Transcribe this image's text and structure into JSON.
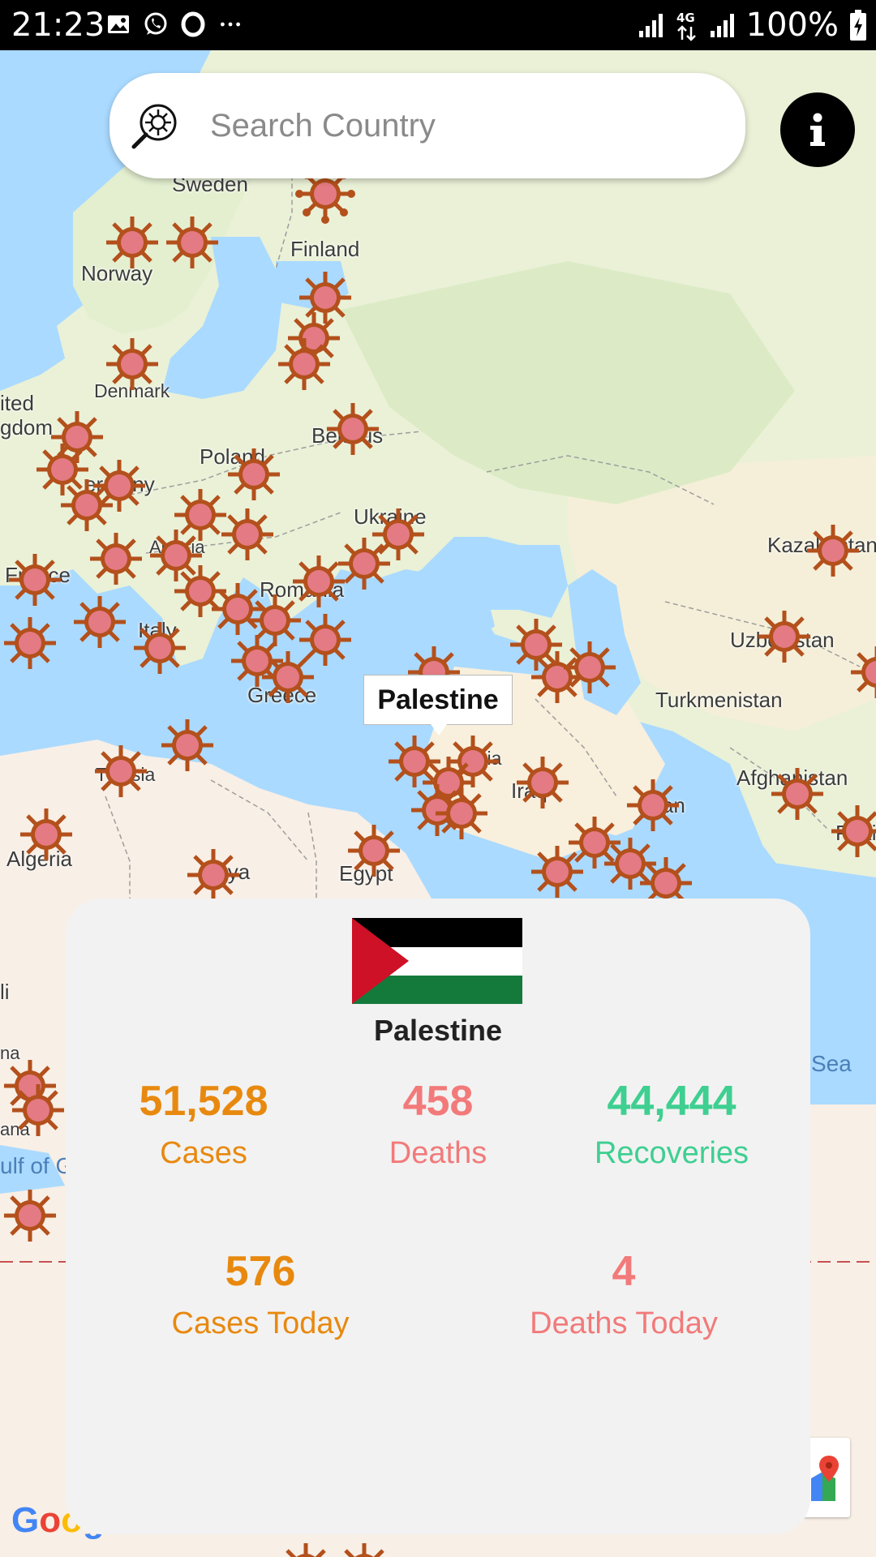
{
  "status_bar": {
    "time": "21:23",
    "battery": "100%",
    "icons_left": [
      "image-icon",
      "whatsapp-icon",
      "opera-icon",
      "more-icon"
    ],
    "icons_right": [
      "signal-icon",
      "network-4g-icon",
      "signal-icon",
      "battery-icon"
    ]
  },
  "search": {
    "placeholder": "Search Country"
  },
  "map": {
    "places": [
      {
        "label": "Sweden"
      },
      {
        "label": "Finland"
      },
      {
        "label": "Norway"
      },
      {
        "label": "Denmark"
      },
      {
        "label": "ited"
      },
      {
        "label": "gdom"
      },
      {
        "label": "Poland"
      },
      {
        "label": "Belarus"
      },
      {
        "label": "ermany"
      },
      {
        "label": "Ukraine"
      },
      {
        "label": "Kazakhstan"
      },
      {
        "label": "France"
      },
      {
        "label": "Austria"
      },
      {
        "label": "Romania"
      },
      {
        "label": "Italy"
      },
      {
        "label": "Uzbekistan"
      },
      {
        "label": "Turkmenistan"
      },
      {
        "label": "Greece"
      },
      {
        "label": "Syria"
      },
      {
        "label": "Iraq"
      },
      {
        "label": "Afghanistan"
      },
      {
        "label": "Iran"
      },
      {
        "label": "Tunisia"
      },
      {
        "label": "Pakista"
      },
      {
        "label": "Algeria"
      },
      {
        "label": "Libya"
      },
      {
        "label": "Egypt"
      },
      {
        "label": "li"
      },
      {
        "label": "na"
      },
      {
        "label": "ana"
      }
    ],
    "seas": [
      {
        "label": "Sea"
      },
      {
        "label": "ulf of G"
      }
    ],
    "marker_tooltip": "Palestine",
    "google_logo": "Goog"
  },
  "country_card": {
    "flag_icon": "palestine-flag-icon",
    "country": "Palestine",
    "stats": [
      {
        "value": "51,528",
        "label": "Cases",
        "color": "#e8890f"
      },
      {
        "value": "458",
        "label": "Deaths",
        "color": "#f27a7a"
      },
      {
        "value": "44,444",
        "label": "Recoveries",
        "color": "#3ecf91"
      },
      {
        "value": "576",
        "label": "Cases Today",
        "color": "#e8890f"
      },
      {
        "value": "4",
        "label": "Deaths Today",
        "color": "#f27a7a"
      }
    ]
  }
}
